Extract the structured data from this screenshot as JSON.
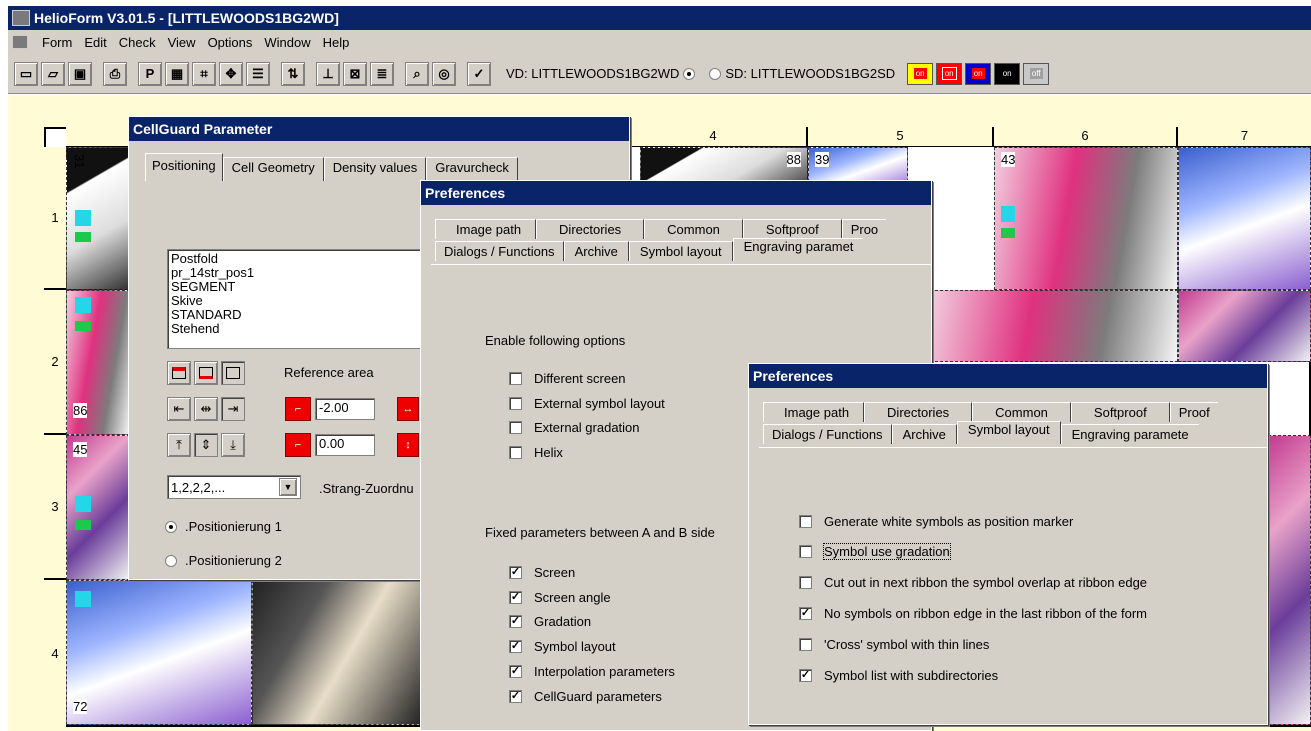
{
  "app": {
    "title": "HelioForm  V3.01.5 - [LITTLEWOODS1BG2WD]",
    "menu": [
      "Form",
      "Edit",
      "Check",
      "View",
      "Options",
      "Window",
      "Help"
    ]
  },
  "toolbar": {
    "vd_label": "VD: LITTLEWOODS1BG2WD",
    "sd_label": "SD: LITTLEWOODS1BG2SD",
    "vd_selected": true,
    "state_buttons": [
      {
        "label": "on",
        "bg": "#ffff00",
        "fg": "#ff0000"
      },
      {
        "label": "on",
        "bg": "#ff0000",
        "fg": "#ffffff"
      },
      {
        "label": "on",
        "bg": "#0000cc",
        "fg": "#ffffff"
      },
      {
        "label": "on",
        "bg": "#000000",
        "fg": "#ffffff"
      },
      {
        "label": "off",
        "bg": "#a0a0a0",
        "fg": "#ffffff"
      }
    ]
  },
  "grid": {
    "columns": [
      "4",
      "5",
      "6",
      "7"
    ],
    "rows": [
      "1",
      "2",
      "3",
      "4"
    ],
    "cell_numbers": [
      "31",
      "39",
      "43",
      "86",
      "45",
      "72",
      "88"
    ]
  },
  "cellguard": {
    "title": "CellGuard Parameter",
    "tabs": [
      "Positioning",
      "Cell Geometry",
      "Density values",
      "Gravurcheck"
    ],
    "list_items": [
      "Postfold",
      "pr_14str_pos1",
      "SEGMENT",
      "Skive",
      "STANDARD",
      "Stehend"
    ],
    "reference_area_label": "Reference area",
    "x_offset": "-2.00",
    "y_offset": "0.00",
    "strang_value": "1,2,2,2,...",
    "strang_label": ".Strang-Zuordnu",
    "radio1": ".Positionierung 1",
    "radio2": ".Positionierung 2"
  },
  "prefs1": {
    "title": "Preferences",
    "tabs_row1": [
      "Image path",
      "Directories",
      "Common",
      "Softproof",
      "Proo"
    ],
    "tabs_row2": [
      "Dialogs / Functions",
      "Archive",
      "Symbol layout",
      "Engraving paramet"
    ],
    "enable_heading": "Enable following options",
    "enable_options": [
      {
        "label": "Different screen",
        "checked": false
      },
      {
        "label": "External symbol layout",
        "checked": false
      },
      {
        "label": "External gradation",
        "checked": false
      },
      {
        "label": "Helix",
        "checked": false
      }
    ],
    "fixed_heading": "Fixed parameters between A and B side",
    "fixed_options": [
      {
        "label": "Screen",
        "checked": true
      },
      {
        "label": "Screen angle",
        "checked": true
      },
      {
        "label": "Gradation",
        "checked": true
      },
      {
        "label": "Symbol layout",
        "checked": true
      },
      {
        "label": "Interpolation parameters",
        "checked": true
      },
      {
        "label": "CellGuard parameters",
        "checked": true
      }
    ]
  },
  "prefs2": {
    "title": "Preferences",
    "tabs_row1": [
      "Image path",
      "Directories",
      "Common",
      "Softproof",
      "Proof"
    ],
    "tabs_row2": [
      "Dialogs / Functions",
      "Archive",
      "Symbol layout",
      "Engraving paramete"
    ],
    "options": [
      {
        "label": "Generate white symbols as position marker",
        "checked": false
      },
      {
        "label": "Symbol use gradation",
        "checked": false
      },
      {
        "label": "Cut out in next ribbon the symbol overlap at ribbon edge",
        "checked": false
      },
      {
        "label": "No symbols on ribbon edge in the last ribbon of the form",
        "checked": true
      },
      {
        "label": "'Cross' symbol with thin lines",
        "checked": false
      },
      {
        "label": "Symbol list with subdirectories",
        "checked": true
      }
    ]
  },
  "colors": {
    "title_bar": "#0a246a",
    "chrome": "#d4d0c8",
    "workspace": "#fffbd4"
  }
}
